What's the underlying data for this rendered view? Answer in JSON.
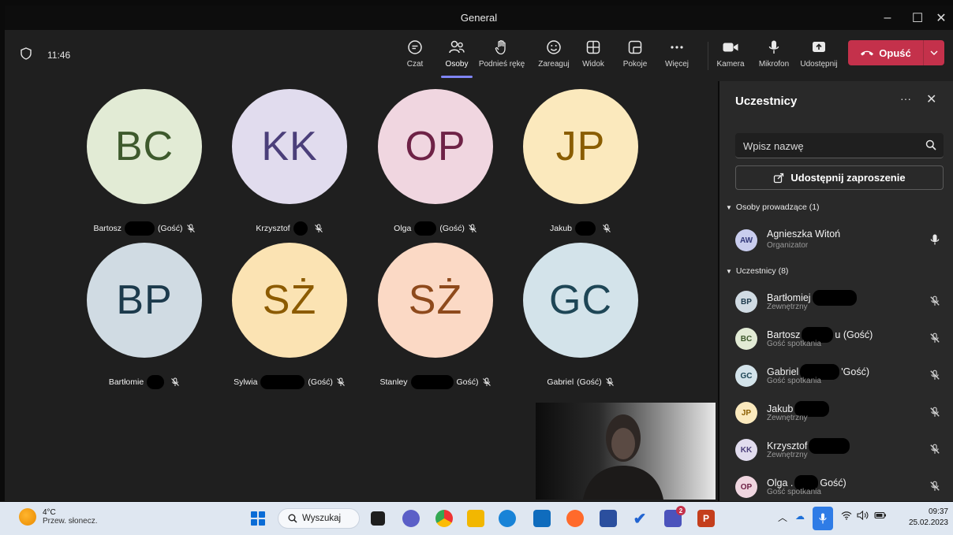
{
  "window": {
    "title": "General"
  },
  "toolbar": {
    "time": "11:46",
    "buttons": [
      "Czat",
      "Osoby",
      "Podnieś rękę",
      "Zareaguj",
      "Widok",
      "Pokoje",
      "Więcej",
      "Kamera",
      "Mikrofon",
      "Udostępnij"
    ],
    "leave_label": "Opuść",
    "active_tab": "Osoby"
  },
  "stage": {
    "tiles": [
      {
        "initials": "BC",
        "first": "Bartosz",
        "suffix": "(Gość)",
        "bg": "#e2ebd5",
        "fg": "#3e5a2d"
      },
      {
        "initials": "KK",
        "first": "Krzysztof",
        "suffix": "",
        "bg": "#e1dcee",
        "fg": "#4b3f7a"
      },
      {
        "initials": "OP",
        "first": "Olga",
        "suffix": "(Gość)",
        "bg": "#f0d6e0",
        "fg": "#6e2246"
      },
      {
        "initials": "JP",
        "first": "Jakub",
        "suffix": "",
        "bg": "#fbe9bd",
        "fg": "#8a5d00"
      },
      {
        "initials": "BP",
        "first": "Bartłomie",
        "suffix": "",
        "bg": "#d0dbe3",
        "fg": "#1c3a4c"
      },
      {
        "initials": "SŻ",
        "first": "Sylwia",
        "suffix": "(Gość)",
        "bg": "#fbe3b3",
        "fg": "#8c5b00"
      },
      {
        "initials": "SŻ",
        "first": "Stanley",
        "suffix": "Gość)",
        "bg": "#fbd9c5",
        "fg": "#8e4a1c"
      },
      {
        "initials": "GC",
        "first": "Gabriel",
        "suffix": "(Gość)",
        "bg": "#d3e3ea",
        "fg": "#1e4656"
      }
    ]
  },
  "panel": {
    "title": "Uczestnicy",
    "search_placeholder": "Wpisz nazwę",
    "invite_label": "Udostępnij zaproszenie",
    "organizers_header": "Osoby prowadzące (1)",
    "participants_header": "Uczestnicy (8)",
    "organizer": {
      "initials": "AW",
      "name": "Agnieszka Witoń",
      "role": "Organizator",
      "bg": "#c9cdee",
      "fg": "#33397a"
    },
    "participants": [
      {
        "initials": "BP",
        "name": "Bartłomiej",
        "suffix": "",
        "role": "Zewnętrzny",
        "bg": "#d0dbe3",
        "fg": "#1c3a4c"
      },
      {
        "initials": "BC",
        "name": "Bartosz",
        "suffix": "u (Gość)",
        "role": "Gość spotkania",
        "bg": "#e2ebd5",
        "fg": "#3e5a2d"
      },
      {
        "initials": "GC",
        "name": "Gabriel",
        "suffix": "'Gość)",
        "role": "Gość spotkania",
        "bg": "#d3e3ea",
        "fg": "#1e4656"
      },
      {
        "initials": "JP",
        "name": "Jakub",
        "suffix": "",
        "role": "Zewnętrzny",
        "bg": "#fbe9bd",
        "fg": "#8a5d00"
      },
      {
        "initials": "KK",
        "name": "Krzysztof",
        "suffix": "",
        "role": "Zewnętrzny",
        "bg": "#e1dcee",
        "fg": "#4b3f7a"
      },
      {
        "initials": "OP",
        "name": "Olga .",
        "suffix": "Gość)",
        "role": "Gość spotkania",
        "bg": "#f0d6e0",
        "fg": "#6e2246"
      }
    ]
  },
  "taskbar": {
    "temperature": "4°C",
    "weather": "Przew. słonecz.",
    "search_label": "Wyszukaj",
    "teams_badge": "2",
    "time": "09:37",
    "date": "25.02.2023"
  }
}
